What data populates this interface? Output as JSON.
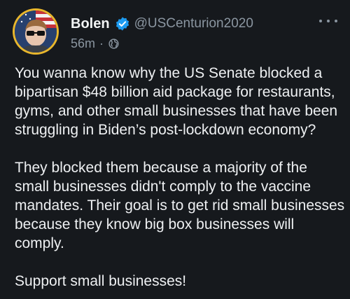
{
  "user": {
    "display_name": "Bolen",
    "handle": "@USCenturion2020",
    "verified": true,
    "avatar_frame_color": "#e8b62c"
  },
  "meta": {
    "time": "56m",
    "separator": "·",
    "visibility_icon": "globe-icon"
  },
  "menu": {
    "icon": "more-options-icon"
  },
  "tweet": {
    "paragraphs": [
      "You wanna know why the US Senate blocked a bipartisan $48 billion aid package for restaurants, gyms, and other small businesses that have been struggling in Biden’s post-lockdown economy?",
      "They blocked them because a majority of the small businesses didn't comply to the vaccine mandates. Their goal is to get rid small businesses because they know big box businesses will comply.",
      "Support small businesses!"
    ]
  },
  "colors": {
    "background": "#16191d",
    "text": "#eef0f2",
    "muted": "#8b96a1",
    "verified_badge": "#1d9bf0"
  }
}
